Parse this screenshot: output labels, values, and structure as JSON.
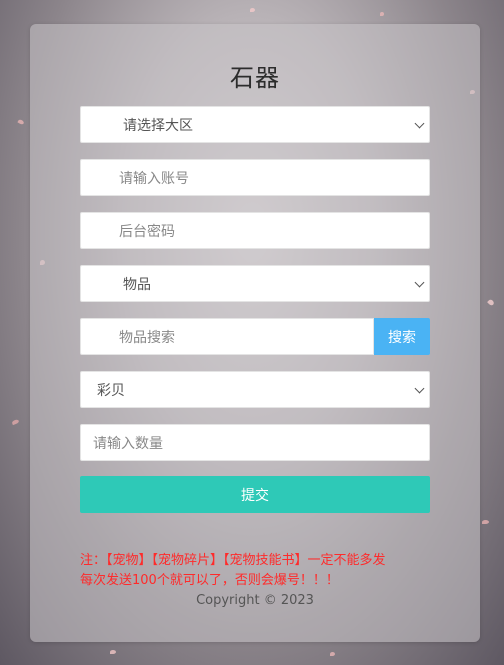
{
  "form": {
    "title": "石器",
    "server_select": "请选择大区",
    "account_placeholder": "请输入账号",
    "password_placeholder": "后台密码",
    "item_select": "物品",
    "item_search_placeholder": "物品搜索",
    "search_button": "搜索",
    "currency_select": "彩贝",
    "quantity_placeholder": "请输入数量",
    "submit_button": "提交",
    "notice_line1": "注：【宠物】【宠物碎片】【宠物技能书】一定不能多发",
    "notice_line2": "每次发送100个就可以了，否则会爆号！！！",
    "copyright": "Copyright © 2023"
  },
  "colors": {
    "submit": "#2ec9b7",
    "search": "#4ab3f4",
    "notice": "#ff2a2a"
  }
}
